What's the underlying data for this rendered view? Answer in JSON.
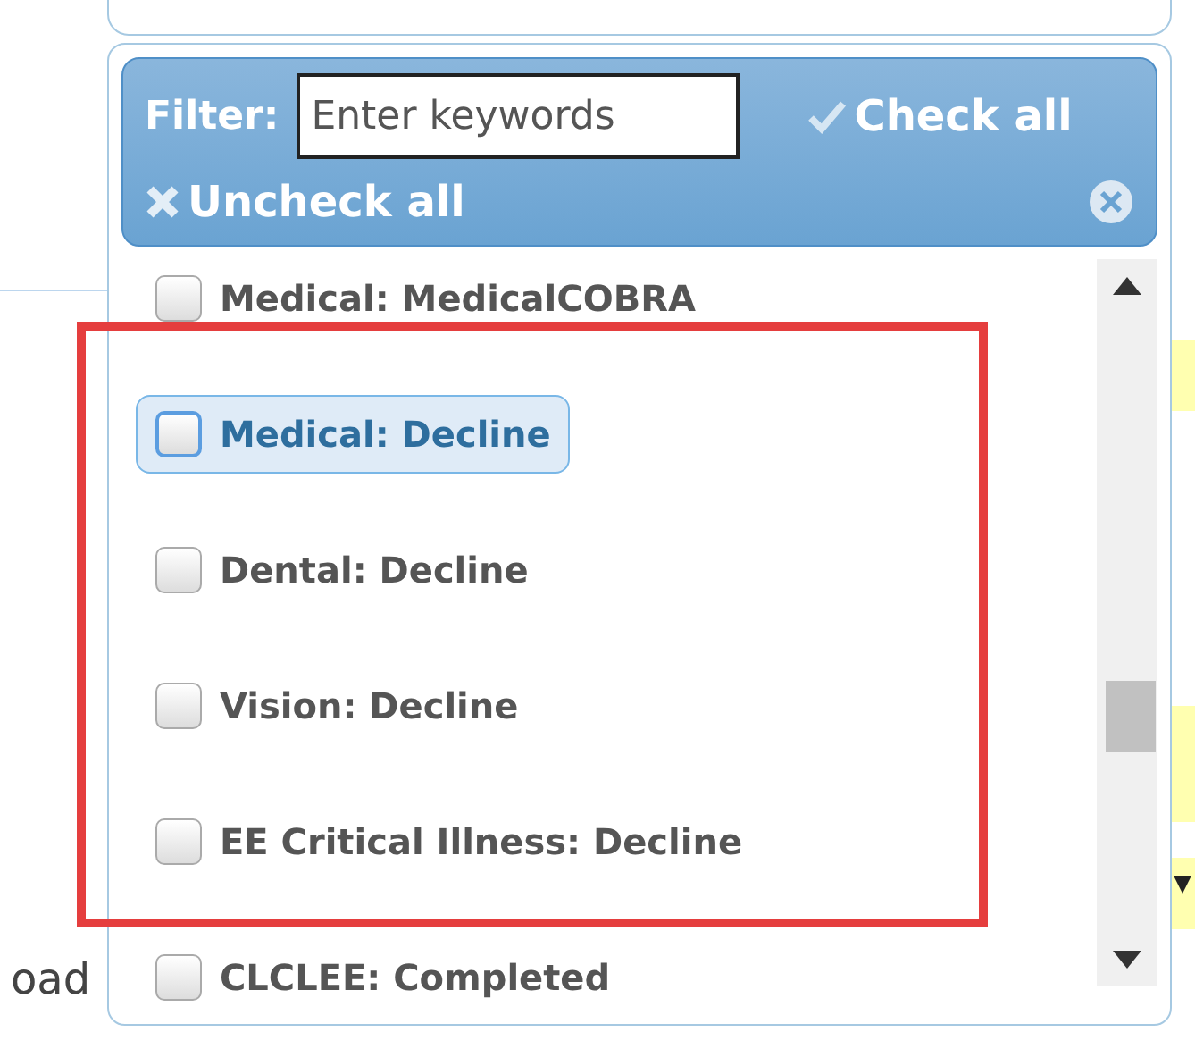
{
  "filter": {
    "label": "Filter:",
    "placeholder": "Enter keywords"
  },
  "actions": [
    {
      "kind": "check",
      "label": "Check all"
    },
    {
      "kind": "uncheck",
      "label": "Uncheck all"
    }
  ],
  "options": [
    {
      "label": "Medical: MedicalCOBRA",
      "checked": false,
      "selected": false
    },
    {
      "label": "Medical: Decline",
      "checked": false,
      "selected": true
    },
    {
      "label": "Dental: Decline",
      "checked": false,
      "selected": false
    },
    {
      "label": "Vision: Decline",
      "checked": false,
      "selected": false
    },
    {
      "label": "EE Critical Illness: Decline",
      "checked": false,
      "selected": false
    },
    {
      "label": "CLCLEE: Completed",
      "checked": false,
      "selected": false
    }
  ],
  "background_label": "oad"
}
